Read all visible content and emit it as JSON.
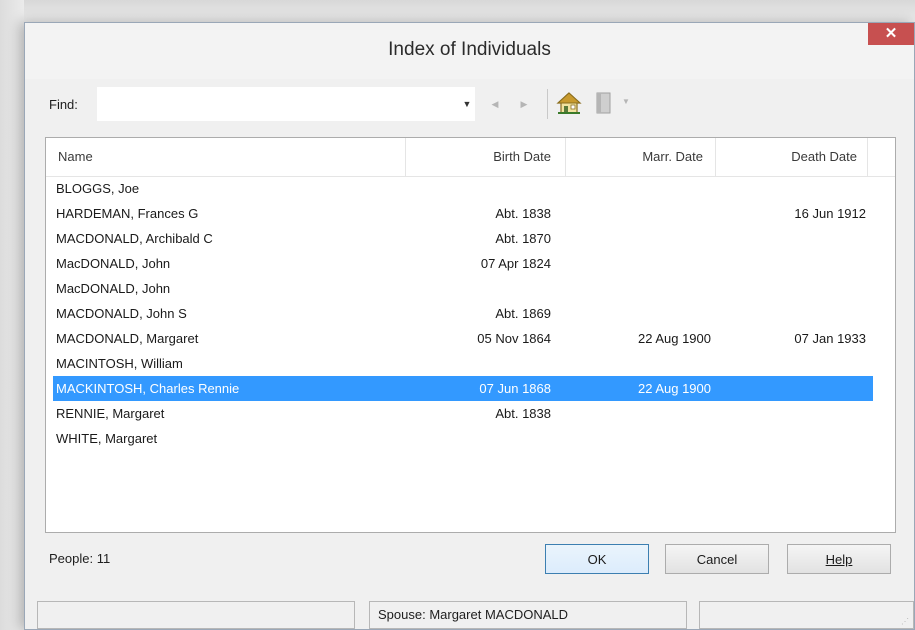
{
  "window": {
    "title": "Index of Individuals",
    "close_symbol": "✕"
  },
  "toolbar": {
    "find_label": "Find:",
    "find_value": "",
    "dropdown_icon": "caret-down-icon",
    "back_icon": "arrow-left-icon",
    "forward_icon": "arrow-right-icon",
    "home_icon": "home-icon",
    "book_icon": "book-icon",
    "book_menu_icon": "caret-down-icon"
  },
  "list": {
    "columns": [
      "Name",
      "Birth Date",
      "Marr. Date",
      "Death Date"
    ],
    "rows": [
      {
        "name": "BLOGGS, Joe",
        "birth": "",
        "marr": "",
        "death": "",
        "selected": false
      },
      {
        "name": "HARDEMAN, Frances G",
        "birth": "Abt. 1838",
        "marr": "",
        "death": "16 Jun 1912",
        "selected": false
      },
      {
        "name": "MACDONALD, Archibald C",
        "birth": "Abt. 1870",
        "marr": "",
        "death": "",
        "selected": false
      },
      {
        "name": "MacDONALD, John",
        "birth": "07 Apr 1824",
        "marr": "",
        "death": "",
        "selected": false
      },
      {
        "name": "MacDONALD, John",
        "birth": "",
        "marr": "",
        "death": "",
        "selected": false
      },
      {
        "name": "MACDONALD, John S",
        "birth": "Abt. 1869",
        "marr": "",
        "death": "",
        "selected": false
      },
      {
        "name": "MACDONALD, Margaret",
        "birth": "05 Nov 1864",
        "marr": "22 Aug 1900",
        "death": "07 Jan 1933",
        "selected": false
      },
      {
        "name": "MACINTOSH, William",
        "birth": "",
        "marr": "",
        "death": "",
        "selected": false
      },
      {
        "name": "MACKINTOSH, Charles Rennie",
        "birth": "07 Jun 1868",
        "marr": "22 Aug 1900",
        "death": "",
        "selected": true
      },
      {
        "name": "RENNIE, Margaret",
        "birth": "Abt. 1838",
        "marr": "",
        "death": "",
        "selected": false
      },
      {
        "name": "WHITE, Margaret",
        "birth": "",
        "marr": "",
        "death": "",
        "selected": false
      }
    ]
  },
  "footer": {
    "people_count": "People: 11",
    "ok_label": "OK",
    "cancel_label": "Cancel",
    "help_label": "Help"
  },
  "status": {
    "pane1": "",
    "pane2": "Spouse: Margaret MACDONALD",
    "pane3": ""
  },
  "colors": {
    "selection": "#3399ff",
    "close_button": "#c75050"
  }
}
